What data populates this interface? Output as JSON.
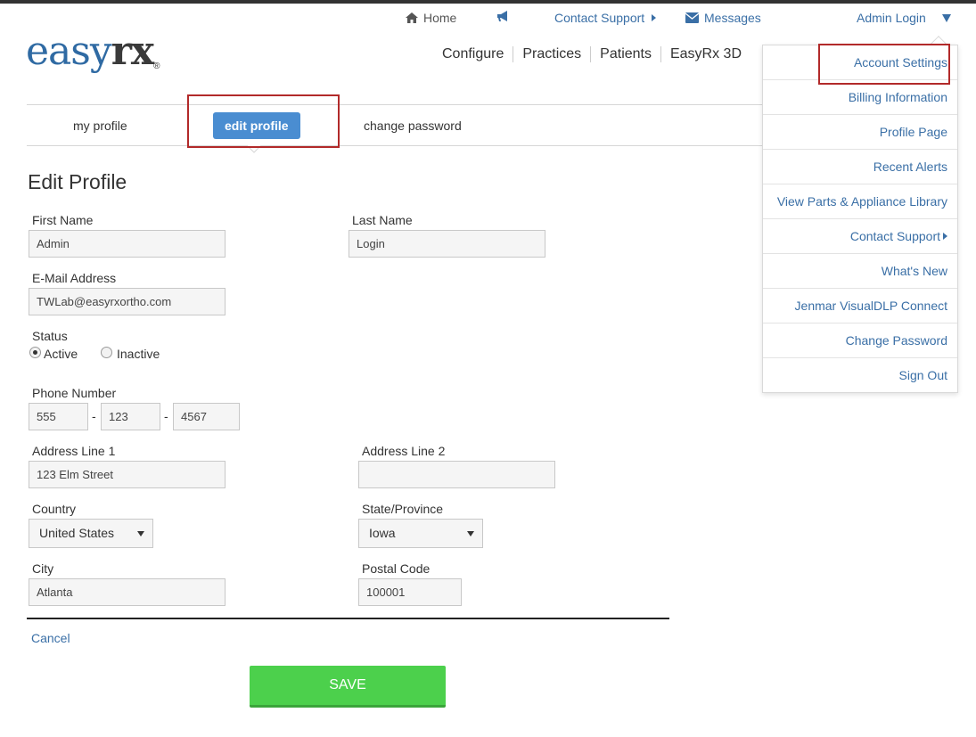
{
  "top_links": {
    "home": "Home",
    "contact_support": "Contact Support",
    "messages": "Messages",
    "admin": "Admin Login"
  },
  "logo": {
    "part1": "easy",
    "part2": "rx",
    "reg": "®"
  },
  "main_nav": [
    "Configure",
    "Practices",
    "Patients",
    "EasyRx 3D"
  ],
  "sub_tabs": {
    "my_profile": "my profile",
    "edit_profile": "edit profile",
    "change_password": "change password"
  },
  "form": {
    "title": "Edit Profile",
    "first_name": {
      "label": "First Name",
      "value": "Admin"
    },
    "last_name": {
      "label": "Last Name",
      "value": "Login"
    },
    "email": {
      "label": "E-Mail Address",
      "value": "TWLab@easyrxortho.com"
    },
    "status": {
      "label": "Status",
      "options": [
        "Active",
        "Inactive"
      ],
      "selected": "Active"
    },
    "phone": {
      "label": "Phone Number",
      "part1": "555",
      "part2": "123",
      "part3": "4567",
      "sep": "-"
    },
    "address1": {
      "label": "Address Line 1",
      "value": "123 Elm Street"
    },
    "address2": {
      "label": "Address Line 2",
      "value": ""
    },
    "country": {
      "label": "Country",
      "value": "United States"
    },
    "state": {
      "label": "State/Province",
      "value": "Iowa"
    },
    "city": {
      "label": "City",
      "value": "Atlanta"
    },
    "postal": {
      "label": "Postal Code",
      "value": "100001"
    },
    "cancel": "Cancel",
    "save": "SAVE"
  },
  "dropdown": [
    "Account Settings",
    "Billing Information",
    "Profile Page",
    "Recent Alerts",
    "View Parts & Appliance Library",
    "Contact Support",
    "What's New",
    "Jenmar VisualDLP Connect",
    "Change Password",
    "Sign Out"
  ],
  "colors": {
    "link": "#3a6fa6",
    "accent": "#4a8dd1",
    "save": "#4cd04c",
    "highlight": "#b22a2a"
  }
}
